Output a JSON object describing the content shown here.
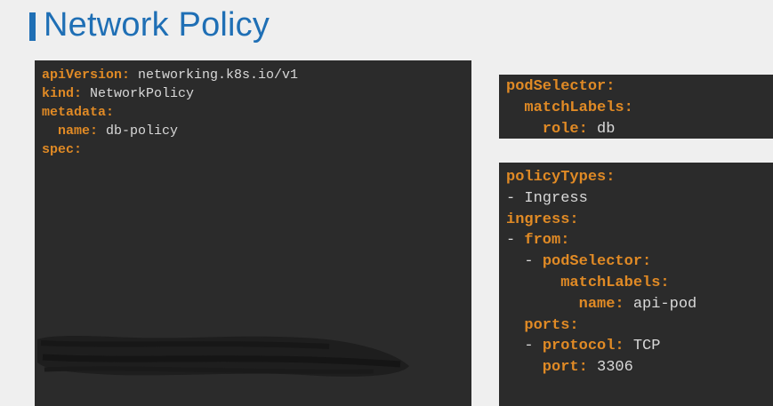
{
  "header": {
    "title": "Network Policy"
  },
  "left_panel": {
    "lines": [
      {
        "key": "apiVersion:",
        "value": " networking.k8s.io/v1"
      },
      {
        "key": "kind:",
        "value": " NetworkPolicy"
      },
      {
        "key": "metadata:",
        "value": ""
      },
      {
        "key": "  name:",
        "value": " db-policy"
      },
      {
        "key": "spec:",
        "value": ""
      }
    ]
  },
  "right_top_panel": {
    "lines": [
      {
        "key": "podSelector:",
        "value": ""
      },
      {
        "key": "  matchLabels:",
        "value": ""
      },
      {
        "key": "    role:",
        "value": " db"
      }
    ]
  },
  "right_bottom_panel": {
    "lines": [
      {
        "dash": "",
        "key": "policyTypes:",
        "value": ""
      },
      {
        "dash": "- ",
        "key": "",
        "value": "Ingress"
      },
      {
        "dash": "",
        "key": "ingress:",
        "value": ""
      },
      {
        "dash": "- ",
        "key": "from:",
        "value": ""
      },
      {
        "dash": "  - ",
        "key": "podSelector:",
        "value": ""
      },
      {
        "dash": "",
        "key": "      matchLabels:",
        "value": ""
      },
      {
        "dash": "",
        "key": "        name:",
        "value": " api-pod"
      },
      {
        "dash": "",
        "key": "  ports:",
        "value": ""
      },
      {
        "dash": "  - ",
        "key": "protocol:",
        "value": " TCP"
      },
      {
        "dash": "",
        "key": "    port:",
        "value": " 3306"
      }
    ]
  },
  "colors": {
    "title": "#1f6fb5",
    "panel_bg": "#2b2b2b",
    "yaml_key": "#e08a25",
    "yaml_value": "#d9d9d9",
    "page_bg": "#efefef"
  }
}
